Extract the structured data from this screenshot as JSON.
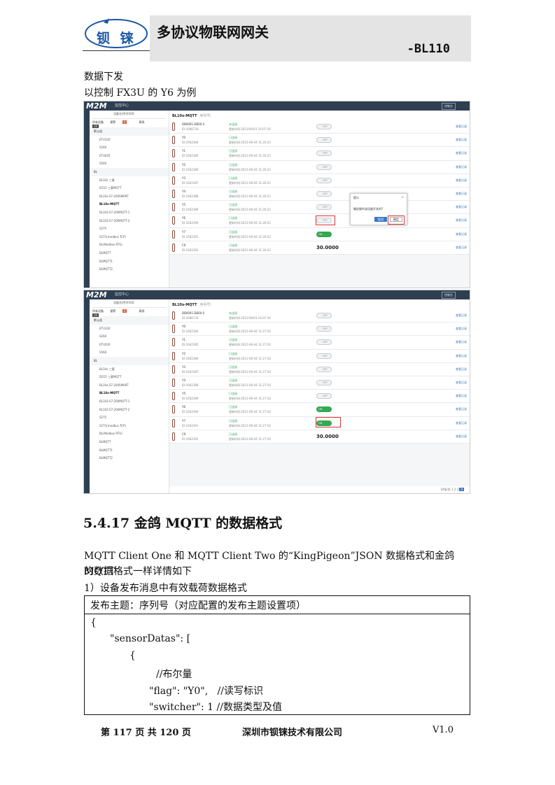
{
  "header": {
    "logo_text": "钡 铼",
    "title": "多协议物联网网关",
    "model": "-BL110"
  },
  "intro": {
    "line1": "数据下发",
    "line2": "以控制 FX3U 的 Y6 为例"
  },
  "screenshot1": {
    "brand": "M2M",
    "nav_title": "监控中心",
    "top_button": "控制台",
    "tree_search": "设备名/序列号ID",
    "tabs": [
      "所有设备",
      "报警",
      "离线"
    ],
    "badge_alarm": "0",
    "badge_offline": "20",
    "tree_nodes": [
      "默认组",
      "ETU320",
      "S260",
      "ETU020",
      "S560",
      "BL",
      "BL10x 三菱",
      "D215 三菱MQTT",
      "BL10x-S7-200SMART",
      "BL10x-MQTT",
      "BL102-S7-200MQTT-1",
      "BL102-S7-200MQTT-2",
      "S275",
      "S271(modbus TCP)",
      "BL(Modbus RTU)",
      "BLMQTT",
      "BLMQTT1",
      "BLMQTT2"
    ],
    "crumb": "BL10x-MQTT",
    "crumb_sub": "序列号：",
    "rows": [
      {
        "name": "DB0001.DB00.0",
        "id": "ID:1686734",
        "status": "未连接",
        "time": "更新时间:2021/06/03 16:07:30",
        "ctrl": "OFF"
      },
      {
        "name": "Y0",
        "id": "ID:1662384",
        "status": "已连接",
        "time": "更新时间:2021-06-04 11:26:22",
        "ctrl": "OFF"
      },
      {
        "name": "Y1",
        "id": "ID:1662385",
        "status": "已连接",
        "time": "更新时间:2021-06-04 11:26:22",
        "ctrl": "OFF"
      },
      {
        "name": "Y2",
        "id": "ID:1662386",
        "status": "已连接",
        "time": "更新时间:2021-06-04 11:26:22",
        "ctrl": "OFF"
      },
      {
        "name": "Y3",
        "id": "ID:1662387",
        "status": "已连接",
        "time": "更新时间:2021-06-04 11:26:22",
        "ctrl": "OFF"
      },
      {
        "name": "Y4",
        "id": "ID:1662388",
        "status": "已连接",
        "time": "更新时间:2021-06-04 11:26:22",
        "ctrl": "OFF"
      },
      {
        "name": "Y5",
        "id": "ID:1662389",
        "status": "已连接",
        "time": "更新时间:2021-06-04 11:26:22",
        "ctrl": "OFF"
      },
      {
        "name": "Y6",
        "id": "ID:1662390",
        "status": "已连接",
        "time": "更新时间:2021-06-04 11:26:22",
        "ctrl": "OFF"
      },
      {
        "name": "Y7",
        "id": "ID:1662391",
        "status": "已连接",
        "time": "更新时间:2021-06-04 11:26:22",
        "ctrl": "ON"
      },
      {
        "name": "C0",
        "id": "ID:1662392",
        "status": "已连接",
        "time": "更新时间:2021-06-04 11:26:22",
        "ctrl": "30.0000"
      }
    ],
    "row_actions": "查看记录",
    "dialog": {
      "title": "提示",
      "close": "×",
      "message": "确定操作该设备开关吗?",
      "ok": "确定",
      "cancel": "取消"
    }
  },
  "screenshot2": {
    "brand": "M2M",
    "nav_title": "监控中心",
    "top_button": "控制台",
    "tree_search": "设备名/序列号ID",
    "tabs": [
      "所有设备",
      "报警",
      "离线"
    ],
    "badge_alarm": "0",
    "badge_offline": "20",
    "tree_nodes": [
      "默认组",
      "ETU320",
      "S260",
      "ETU020",
      "S560",
      "BL",
      "BL10x 三菱",
      "D215 三菱MQTT",
      "BL10x-S7-200SMART",
      "BL10x-MQTT",
      "BL102-S7-200MQTT-1",
      "BL102-S7-200MQTT-2",
      "S275",
      "S271(modbus TCP)",
      "BL(Modbus RTU)",
      "BLMQTT",
      "BLMQTT1",
      "BLMQTT2"
    ],
    "crumb": "BL10x-MQTT",
    "crumb_sub": "序列号：",
    "rows": [
      {
        "name": "DB0001.DB00.0",
        "id": "ID:1686734",
        "status": "未连接",
        "time": "更新时间:2021/06/03 16:07:30",
        "ctrl": "OFF"
      },
      {
        "name": "Y0",
        "id": "ID:1662384",
        "status": "已连接",
        "time": "更新时间:2021-06-04 11:27:54",
        "ctrl": "OFF"
      },
      {
        "name": "Y1",
        "id": "ID:1662385",
        "status": "已连接",
        "time": "更新时间:2021-06-04 11:27:54",
        "ctrl": "OFF"
      },
      {
        "name": "Y2",
        "id": "ID:1662386",
        "status": "已连接",
        "time": "更新时间:2021-06-04 11:27:54",
        "ctrl": "OFF"
      },
      {
        "name": "Y3",
        "id": "ID:1662387",
        "status": "已连接",
        "time": "更新时间:2021-06-04 11:27:54",
        "ctrl": "OFF"
      },
      {
        "name": "Y4",
        "id": "ID:1662388",
        "status": "已连接",
        "time": "更新时间:2021-06-04 11:27:54",
        "ctrl": "OFF"
      },
      {
        "name": "Y5",
        "id": "ID:1662389",
        "status": "已连接",
        "time": "更新时间:2021-06-04 11:27:54",
        "ctrl": "OFF"
      },
      {
        "name": "Y6",
        "id": "ID:1662390",
        "status": "已连接",
        "time": "更新时间:2021-06-04 11:27:54",
        "ctrl": "ON"
      },
      {
        "name": "Y7",
        "id": "ID:1662391",
        "status": "已连接",
        "time": "更新时间:2021-06-04 11:27:54",
        "ctrl": "ON"
      },
      {
        "name": "C0",
        "id": "ID:1662392",
        "status": "已连接",
        "time": "更新时间:2021-06-04 11:27:54",
        "ctrl": "30.0000"
      }
    ],
    "row_actions": "查看记录",
    "pager": {
      "total": "10条/页",
      "pages": [
        "1",
        "2",
        "3",
        "4"
      ],
      "current": "4"
    }
  },
  "section": {
    "heading": "5.4.17 金鸽 MQTT 的数据格式",
    "para_line1": "MQTT Client One  和 MQTT Client Two 的“KingPigeon”JSON 数据格式和金鸽 MQTT",
    "para_line2": "的数据格式一样详情如下",
    "item1": "1）设备发布消息中有效载荷数据格式"
  },
  "code_table": {
    "header": "发布主题：序列号（对应配置的发布主题设置项）",
    "lines": [
      "{",
      "\"sensorDatas\": [",
      "{",
      "//布尔量",
      "\"flag\": \"Y0\",   //读写标识",
      "\"switcher\": 1 //数据类型及值"
    ]
  },
  "footer": {
    "page": "第 117 页 共 120 页",
    "company": "深圳市钡铼技术有限公司",
    "version": "V1.0"
  }
}
